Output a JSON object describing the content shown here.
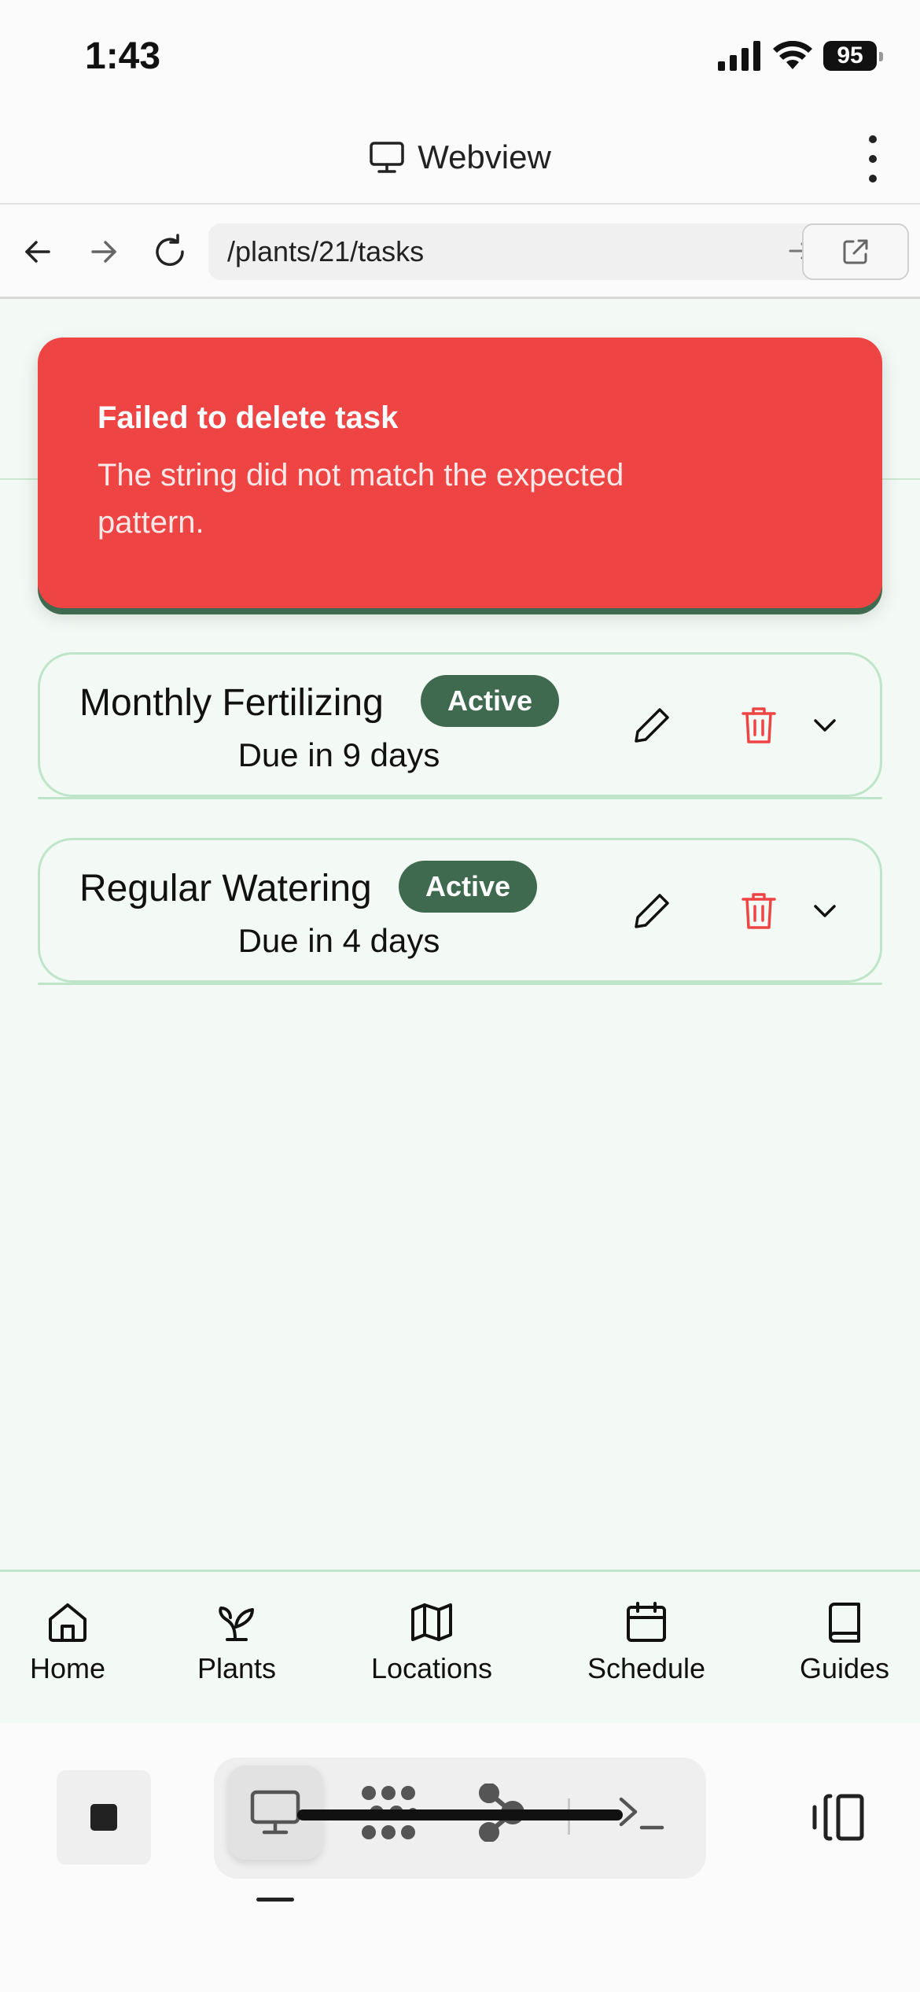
{
  "status_bar": {
    "time": "1:43",
    "battery": "95"
  },
  "webview": {
    "title": "Webview"
  },
  "browser": {
    "url": "/plants/21/tasks"
  },
  "toast": {
    "title": "Failed to delete task",
    "message": "The string did not match the expected pattern.",
    "color": "#ef4444"
  },
  "tasks": [
    {
      "name": "Monthly Fertilizing",
      "status": "Active",
      "due": "Due in 9 days"
    },
    {
      "name": "Regular Watering",
      "status": "Active",
      "due": "Due in 4 days"
    }
  ],
  "bottom_nav": [
    {
      "label": "Home",
      "icon": "home-icon"
    },
    {
      "label": "Plants",
      "icon": "sprout-icon"
    },
    {
      "label": "Locations",
      "icon": "map-icon"
    },
    {
      "label": "Schedule",
      "icon": "calendar-icon"
    },
    {
      "label": "Guides",
      "icon": "book-icon"
    }
  ],
  "colors": {
    "accent_green": "#3f6a4f",
    "app_background": "#f3f9f4",
    "card_border": "#bfe5c8",
    "danger": "#ef4444"
  }
}
